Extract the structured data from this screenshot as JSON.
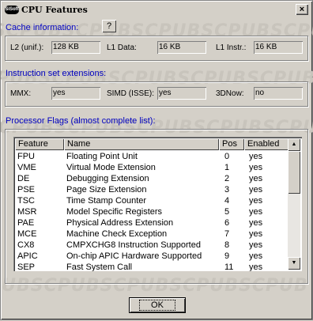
{
  "window": {
    "title": "CPU Features",
    "icon_label": "SiSoft",
    "close_label": "×"
  },
  "watermark_text": "SCPUBSCPUBSCPUBSCPUBSCPUB",
  "cache": {
    "heading": "Cache information:",
    "help_label": "?",
    "l2_label": "L2 (unif.):",
    "l2_value": "128 KB",
    "l1d_label": "L1 Data:",
    "l1d_value": "16 KB",
    "l1i_label": "L1 Instr.:",
    "l1i_value": "16 KB"
  },
  "isa": {
    "heading": "Instruction set extensions:",
    "mmx_label": "MMX:",
    "mmx_value": "yes",
    "simd_label": "SIMD (ISSE):",
    "simd_value": "yes",
    "now_label": "3DNow:",
    "now_value": "no"
  },
  "flags": {
    "heading": "Processor Flags (almost complete list):",
    "columns": [
      "Feature",
      "Name",
      "Pos",
      "Enabled"
    ],
    "rows": [
      [
        "FPU",
        "Floating Point Unit",
        "0",
        "yes"
      ],
      [
        "VME",
        "Virtual Mode Extension",
        "1",
        "yes"
      ],
      [
        "DE",
        "Debugging Extension",
        "2",
        "yes"
      ],
      [
        "PSE",
        "Page Size Extension",
        "3",
        "yes"
      ],
      [
        "TSC",
        "Time Stamp Counter",
        "4",
        "yes"
      ],
      [
        "MSR",
        "Model Specific Registers",
        "5",
        "yes"
      ],
      [
        "PAE",
        "Physical Address Extension",
        "6",
        "yes"
      ],
      [
        "MCE",
        "Machine Check Exception",
        "7",
        "yes"
      ],
      [
        "CX8",
        "CMPXCHG8 Instruction Supported",
        "8",
        "yes"
      ],
      [
        "APIC",
        "On-chip APIC Hardware Supported",
        "9",
        "yes"
      ],
      [
        "SEP",
        "Fast System Call",
        "11",
        "yes"
      ]
    ],
    "scroll_up": "▲",
    "scroll_down": "▼"
  },
  "ok_label": "OK"
}
